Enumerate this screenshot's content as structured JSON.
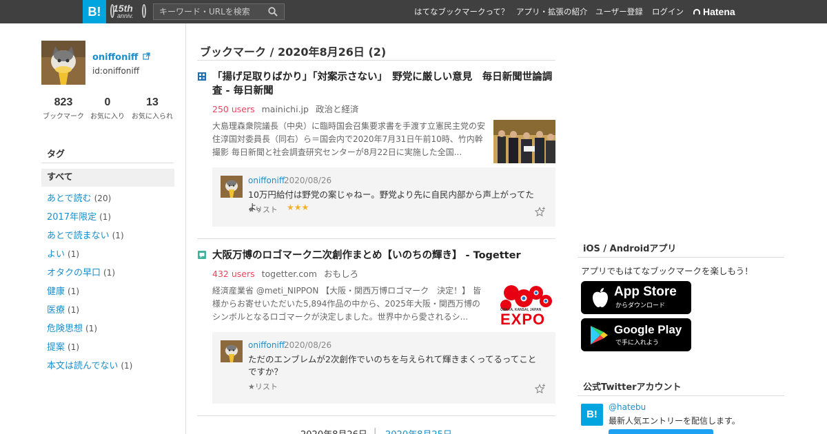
{
  "header": {
    "logo": "B!",
    "anniv_big": "15th",
    "anniv_small": "anniv.",
    "search_placeholder": "キーワード・URLを検索",
    "nav": [
      "はてなブックマークって？",
      "アプリ・拡張の紹介",
      "ユーザー登録",
      "ログイン"
    ],
    "hatena": "Hatena"
  },
  "profile": {
    "name": "oniffoniff",
    "id": "id:oniffoniff",
    "stats": [
      {
        "n": "823",
        "l": "ブックマーク"
      },
      {
        "n": "0",
        "l": "お気に入り"
      },
      {
        "n": "13",
        "l": "お気に入られ"
      }
    ]
  },
  "tags": {
    "title": "タグ",
    "all": "すべて",
    "items": [
      {
        "t": "あとで読む",
        "c": "(20)"
      },
      {
        "t": "2017年限定",
        "c": "(1)"
      },
      {
        "t": "あとで読まない",
        "c": "(1)"
      },
      {
        "t": "よい",
        "c": "(1)"
      },
      {
        "t": "オタクの早口",
        "c": "(1)"
      },
      {
        "t": "健康",
        "c": "(1)"
      },
      {
        "t": "医療",
        "c": "(1)"
      },
      {
        "t": "危険思想",
        "c": "(1)"
      },
      {
        "t": "提案",
        "c": "(1)"
      },
      {
        "t": "本文は読んでない",
        "c": "(1)"
      }
    ]
  },
  "main": {
    "title": "ブックマーク / 2020年8月26日 (2)",
    "entries": [
      {
        "title": "「揚げ足取りばかり」「対案示さない」　野党に厳しい意見　毎日新聞世論調査 - 毎日新聞",
        "users": "250 users",
        "domain": "mainichi.jp",
        "category": "政治と経済",
        "summary": "大島理森衆院議長（中央）に臨時国会召集要求書を手渡す立憲民主党の安住淳国対委員長（同右）ら＝国会内で2020年7月31日午前10時、竹内幹撮影 毎日新聞と社会調査研究センターが8月22日に実施した全国...",
        "comment_user": "oniffoniff",
        "comment_date": "2020/08/26",
        "comment_text": "10万円給付は野党の案じゃねー。野党より先に自民内部から声上がってたよ。",
        "list_label": "★リスト",
        "stars": "★★★"
      },
      {
        "title": "大阪万博のロゴマーク二次創作まとめ【いのちの輝き】 - Togetter",
        "users": "432 users",
        "domain": "togetter.com",
        "category": "おもしろ",
        "summary": "経済産業省 @meti_NIPPON 【大阪・関西万博ロゴマーク　決定！】 皆様からお寄せいただいた5,894作品の中から、2025年大阪・関西万博のシンボルとなるロゴマークが決定しました。世界中から愛されるシ...",
        "thumb_sub": "OSAKA, KANSAI, JAPAN",
        "thumb_main": "EXPO",
        "comment_user": "oniffoniff",
        "comment_date": "2020/08/26",
        "comment_text": "ただのエンブレムが2次創作でいのちを与えられて輝きまくってるってことですか？",
        "list_label": "★リスト"
      }
    ],
    "pager_current": "2020年8月26日",
    "pager_sep": "|",
    "pager_next": "2020年8月25日"
  },
  "right": {
    "apps_title": "iOS / Androidアプリ",
    "apps_text": "アプリでもはてなブックマークを楽しもう！",
    "appstore_main": "App Store",
    "appstore_sub": "からダウンロード",
    "gplay_main": "Google Play",
    "gplay_sub": "で手に入れよう",
    "twitter_title": "公式Twitterアカウント",
    "twitter_icon": "B!",
    "twitter_handle": "@hatebu",
    "twitter_desc": "最新人気エントリーを配信します。"
  }
}
